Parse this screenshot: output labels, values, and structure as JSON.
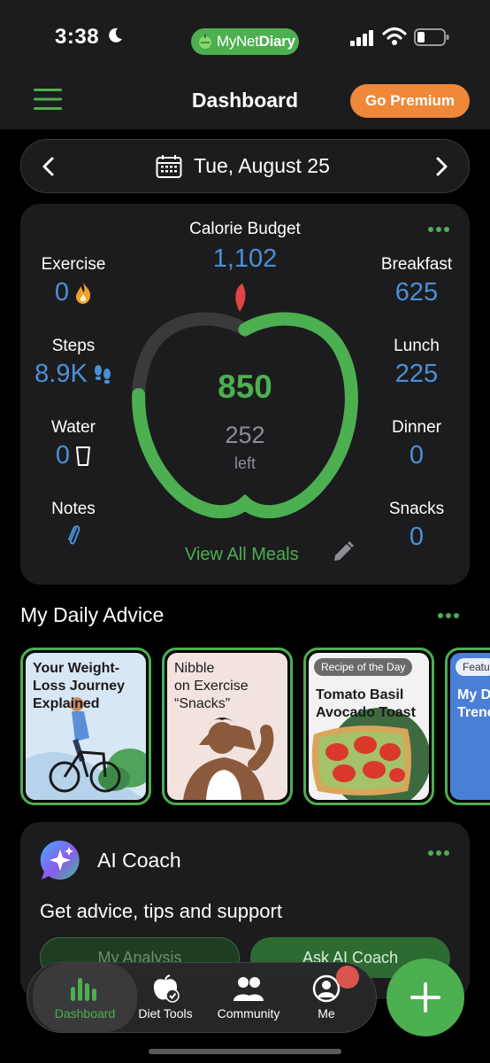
{
  "status_bar": {
    "time": "3:38",
    "app_name_prefix": "MyNet",
    "app_name_suffix": "Diary"
  },
  "header": {
    "title": "Dashboard",
    "premium_label": "Go Premium"
  },
  "date_nav": {
    "date": "Tue, August 25"
  },
  "dashboard": {
    "budget_label": "Calorie Budget",
    "budget_value": "1,102",
    "consumed": "850",
    "left_value": "252",
    "left_label": "left",
    "consumed_fraction": 0.77,
    "exercise": {
      "label": "Exercise",
      "value": "0"
    },
    "steps": {
      "label": "Steps",
      "value": "8.9K"
    },
    "water": {
      "label": "Water",
      "value": "0"
    },
    "notes": {
      "label": "Notes"
    },
    "breakfast": {
      "label": "Breakfast",
      "value": "625"
    },
    "lunch": {
      "label": "Lunch",
      "value": "225"
    },
    "dinner": {
      "label": "Dinner",
      "value": "0"
    },
    "snacks": {
      "label": "Snacks",
      "value": "0"
    },
    "view_meals": "View All Meals"
  },
  "advice": {
    "title": "My Daily Advice",
    "cards": [
      {
        "title_1": "Your Weight-",
        "title_2": "Loss Journey",
        "title_3": "Explained"
      },
      {
        "title_1": "Nibble",
        "title_2": "on Exercise",
        "title_3": "“Snacks”"
      },
      {
        "badge": "Recipe of the Day",
        "title_1": "Tomato Basil",
        "title_2": "Avocado Toast"
      },
      {
        "badge": "Featu",
        "title_1": "My D",
        "title_2": "Trenc"
      }
    ]
  },
  "coach": {
    "title": "AI Coach",
    "subtitle": "Get advice, tips and support",
    "btn_analysis": "My Analysis",
    "btn_ask": "Ask AI Coach"
  },
  "tabs": [
    {
      "label": "Dashboard"
    },
    {
      "label": "Diet Tools"
    },
    {
      "label": "Community"
    },
    {
      "label": "Me"
    }
  ],
  "colors": {
    "accent_green": "#4caf50",
    "value_blue": "#4a90d9",
    "premium_orange": "#f0883a"
  }
}
